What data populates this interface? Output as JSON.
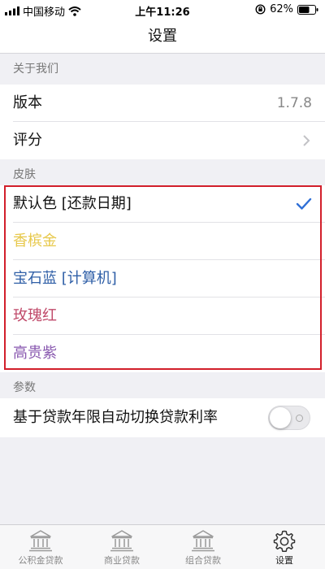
{
  "status_bar": {
    "carrier": "中国移动",
    "time": "上午11:26",
    "battery": "62%"
  },
  "header": {
    "title": "设置"
  },
  "sections": {
    "about": {
      "header": "关于我们",
      "version_label": "版本",
      "version_value": "1.7.8",
      "rating_label": "评分"
    },
    "skin": {
      "header": "皮肤",
      "items": [
        {
          "label": "默认色 [还款日期]",
          "color": "#111111",
          "selected": true
        },
        {
          "label": "香槟金",
          "color": "#e7c84a",
          "selected": false
        },
        {
          "label": "宝石蓝 [计算机]",
          "color": "#2f5fa7",
          "selected": false
        },
        {
          "label": "玫瑰红",
          "color": "#c04a6a",
          "selected": false
        },
        {
          "label": "高贵紫",
          "color": "#8a5ab0",
          "selected": false
        }
      ]
    },
    "params": {
      "header": "参数",
      "auto_rate_label": "基于贷款年限自动切换贷款利率",
      "auto_rate_on": false
    }
  },
  "tabbar": {
    "items": [
      {
        "label": "公积金贷款",
        "icon": "bank-icon",
        "active": false
      },
      {
        "label": "商业贷款",
        "icon": "bank-icon",
        "active": false
      },
      {
        "label": "组合贷款",
        "icon": "bank-icon",
        "active": false
      },
      {
        "label": "设置",
        "icon": "gear-icon",
        "active": true
      }
    ]
  },
  "colors": {
    "accent": "#2f6fd6",
    "highlight_border": "#d21f2b"
  }
}
